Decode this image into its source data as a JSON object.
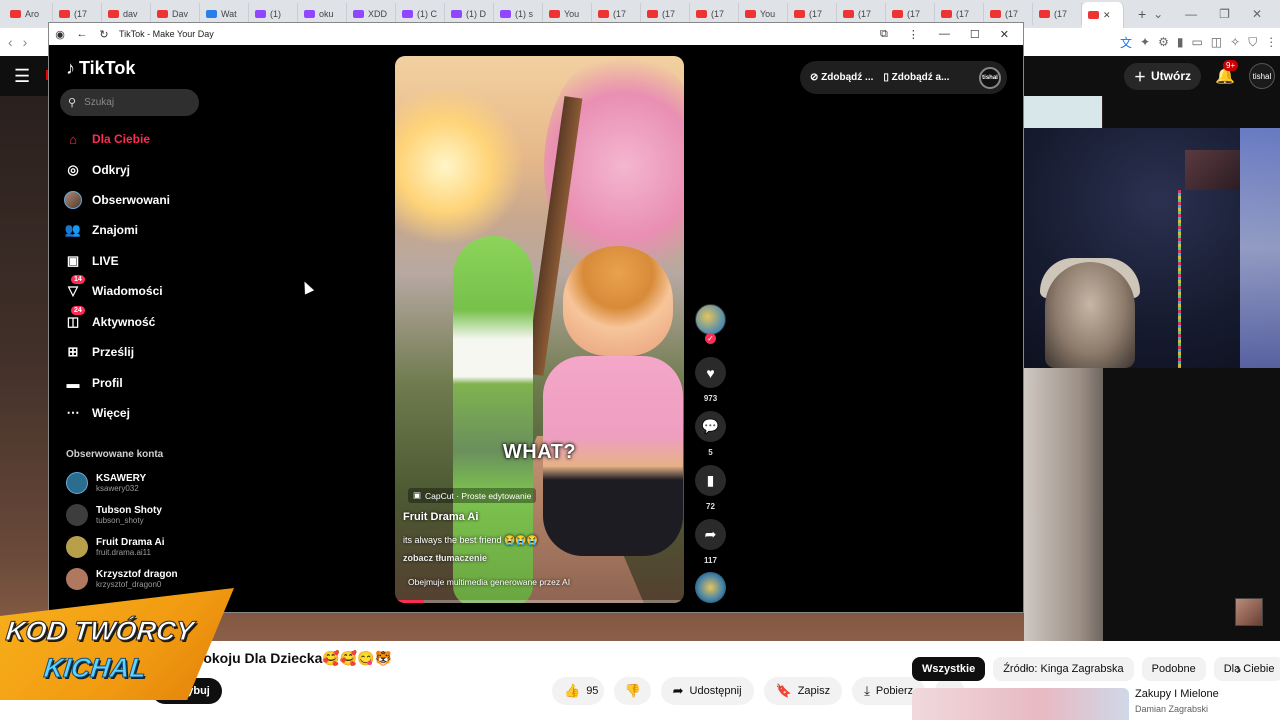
{
  "browser": {
    "tabs": [
      {
        "label": "Aro",
        "color": "#e33"
      },
      {
        "label": "(17",
        "color": "#e33"
      },
      {
        "label": "dav",
        "color": "#e33"
      },
      {
        "label": "Dav",
        "color": "#e33"
      },
      {
        "label": "Wat",
        "color": "#2b7de9"
      },
      {
        "label": "(1)",
        "color": "#9147ff"
      },
      {
        "label": "oku",
        "color": "#9147ff"
      },
      {
        "label": "XDD",
        "color": "#9147ff"
      },
      {
        "label": "(1) C",
        "color": "#9147ff"
      },
      {
        "label": "(1) D",
        "color": "#9147ff"
      },
      {
        "label": "(1) s",
        "color": "#9147ff"
      },
      {
        "label": "You",
        "color": "#e33"
      },
      {
        "label": "(17",
        "color": "#e33"
      },
      {
        "label": "(17",
        "color": "#e33"
      },
      {
        "label": "(17",
        "color": "#e33"
      },
      {
        "label": "You",
        "color": "#e33"
      },
      {
        "label": "(17",
        "color": "#e33"
      },
      {
        "label": "(17",
        "color": "#e33"
      },
      {
        "label": "(17",
        "color": "#e33"
      },
      {
        "label": "(17",
        "color": "#e33"
      },
      {
        "label": "(17",
        "color": "#e33"
      },
      {
        "label": "(17",
        "color": "#e33"
      }
    ],
    "active_tab_close": "✕",
    "new_tab": "+"
  },
  "tiktok_window": {
    "title": "TikTok - Make Your Day",
    "logo": "TikTok",
    "search_placeholder": "Szukaj",
    "nav": [
      {
        "label": "Dla Ciebie",
        "icon": "home-icon"
      },
      {
        "label": "Odkryj",
        "icon": "compass-icon"
      },
      {
        "label": "Obserwowani",
        "icon": "avatar-icon"
      },
      {
        "label": "Znajomi",
        "icon": "friends-icon"
      },
      {
        "label": "LIVE",
        "icon": "live-icon"
      },
      {
        "label": "Wiadomości",
        "icon": "messages-icon",
        "badge": "14"
      },
      {
        "label": "Aktywność",
        "icon": "activity-icon",
        "badge": "24"
      },
      {
        "label": "Prześlij",
        "icon": "upload-icon"
      },
      {
        "label": "Profil",
        "icon": "profile-icon"
      },
      {
        "label": "Więcej",
        "icon": "more-icon"
      }
    ],
    "followed_title": "Obserwowane konta",
    "followed": [
      {
        "name": "KSAWERY",
        "handle": "ksawery032",
        "color": "#2a6d8f"
      },
      {
        "name": "Tubson Shoty",
        "handle": "tubson_shoty",
        "color": "#3d3d3d"
      },
      {
        "name": "Fruit Drama Ai",
        "handle": "fruit.drama.ai11",
        "color": "#b8a04a"
      },
      {
        "name": "Krzysztof dragon",
        "handle": "krzysztof_dragon0",
        "color": "#b0785f"
      }
    ],
    "top_buttons": {
      "coins": "Zdobądź ...",
      "app": "Zdobądź a...",
      "user": "tishal"
    },
    "video": {
      "overlay_text": "WHAT?",
      "capcut": "CapCut · Proste edytowanie",
      "author": "Fruit Drama Ai",
      "caption": "its always the best friend 😭😭😭",
      "translate": "zobacz tłumaczenie",
      "ai_label": "Obejmuje multimedia generowane przez AI",
      "progress": 0.1
    },
    "actions": {
      "likes": "973",
      "comments": "5",
      "saves": "72",
      "shares": "117"
    }
  },
  "youtube": {
    "create_label": "Utwórz",
    "bell_badge": "9+",
    "avatar_label": "tishal",
    "title_fragment": "Pokoju Dla Dziecka🥰🥰😋🐯",
    "subscribe_label": "Subskrybuj",
    "subscribe_visible": "oskrybuj",
    "likes": "95",
    "share_label": "Udostępnij",
    "save_label": "Zapisz",
    "download_label": "Pobierz",
    "chips": [
      "Wszystkie",
      "Źródło: Kinga Zagrabska",
      "Podobne",
      "Dla Ciebie"
    ],
    "rec_title": "Zakupy I Mielone",
    "rec_channel": "Damian Zagrabski"
  },
  "overlay": {
    "line1": "KOD TWÓRCY",
    "line2": "KICHAL"
  }
}
